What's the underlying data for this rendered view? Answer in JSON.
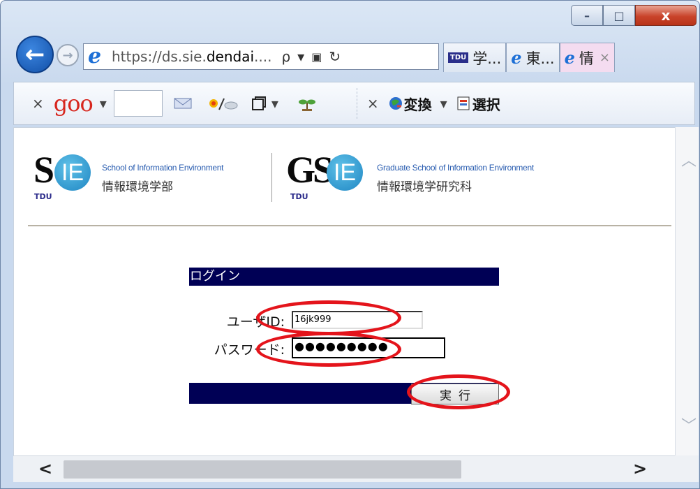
{
  "window": {
    "minimize_glyph": "–",
    "maximize_glyph": "□",
    "close_glyph": "x"
  },
  "nav": {
    "url_scheme": "https://ds.sie.",
    "url_domain": "dendai",
    "url_rest": "....",
    "search_glyph": "ρ",
    "dropdown_glyph": "▾",
    "lock_glyph": "🔒",
    "refresh_glyph": "↻"
  },
  "tabs": [
    {
      "label": "学...",
      "icon": "tdu-icon",
      "icon_text": "TDU"
    },
    {
      "label": "東...",
      "icon": "ie-icon"
    },
    {
      "label": "情",
      "icon": "ie-icon",
      "active": true,
      "close": "×"
    }
  ],
  "toolbar": {
    "close1": "×",
    "goo_label": "goo",
    "dropdown": "▾",
    "close2": "×",
    "convert_label": "変換",
    "select_label": "選択"
  },
  "header": {
    "sie_en": "School of Information Environment",
    "sie_ja": "情報環境学部",
    "gsie_en": "Graduate School of Information Environment",
    "gsie_ja": "情報環境学研究科",
    "sie_letter": "S",
    "gsie_letters": "GS",
    "circle_text": "IE",
    "tdu": "TDU"
  },
  "login": {
    "title": "ログイン",
    "user_label": "ユーザID:",
    "user_value": "16jk999",
    "password_label": "パスワード:",
    "password_value": "●●●●●●●●●",
    "submit_label": "実行"
  },
  "colors": {
    "header_bar": "#000055",
    "annotation": "#e4141b"
  }
}
